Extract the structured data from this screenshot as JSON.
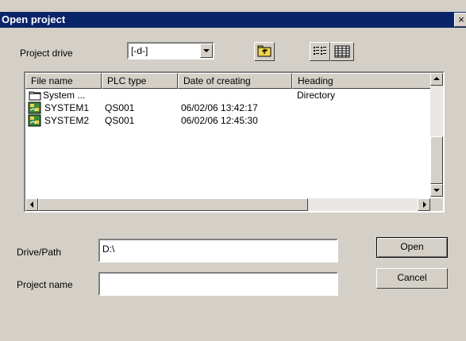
{
  "window": {
    "title": "Open project",
    "close_glyph": "×"
  },
  "project_drive": {
    "label": "Project drive",
    "selected": "[-d-]"
  },
  "toolbar": {
    "up_icon": "folder-up-icon",
    "list_icon": "list-view-icon",
    "details_icon": "details-view-icon"
  },
  "file_list": {
    "columns": [
      "File name",
      "PLC type",
      "Date of creating",
      "Heading"
    ],
    "rows": [
      {
        "icon": "folder-icon",
        "name": "System ...",
        "plc": "",
        "date": "",
        "heading": "Directory"
      },
      {
        "icon": "project-icon",
        "name": "SYSTEM1",
        "plc": "QS001",
        "date": "06/02/06 13:42:17",
        "heading": ""
      },
      {
        "icon": "project-icon",
        "name": "SYSTEM2",
        "plc": "QS001",
        "date": "06/02/06 12:45:30",
        "heading": ""
      }
    ]
  },
  "drive_path": {
    "label": "Drive/Path",
    "value": "D:\\"
  },
  "project_name": {
    "label": "Project name",
    "value": ""
  },
  "buttons": {
    "open": "Open",
    "cancel": "Cancel"
  },
  "colors": {
    "title_bar": "#0a246a",
    "face": "#d4d0c8",
    "project_icon": "#3c8a3c"
  }
}
